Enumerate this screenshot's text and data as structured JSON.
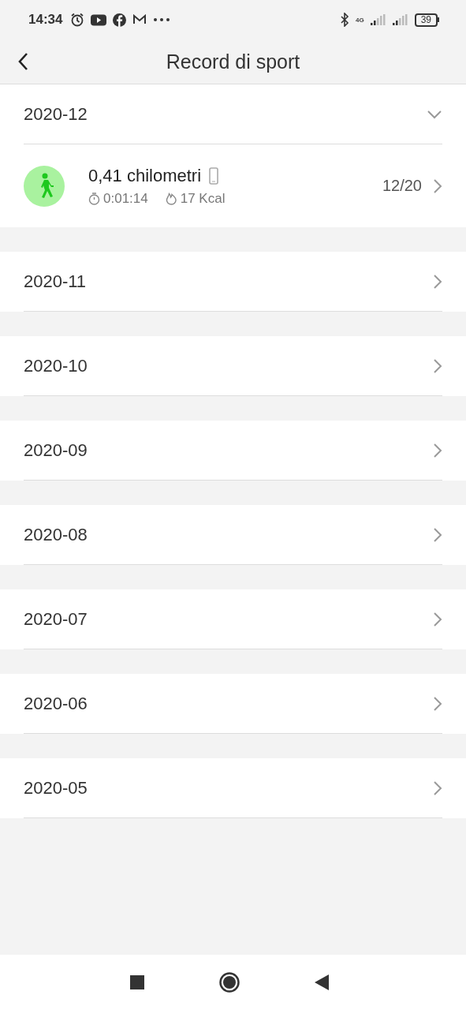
{
  "status_bar": {
    "time": "14:34",
    "network": "4G",
    "battery": "39"
  },
  "header": {
    "title": "Record di sport"
  },
  "months": [
    {
      "label": "2020-12",
      "expanded": true,
      "records": [
        {
          "distance": "0,41 chilometri",
          "duration": "0:01:14",
          "calories": "17 Kcal",
          "date": "12/20"
        }
      ]
    },
    {
      "label": "2020-11",
      "expanded": false
    },
    {
      "label": "2020-10",
      "expanded": false
    },
    {
      "label": "2020-09",
      "expanded": false
    },
    {
      "label": "2020-08",
      "expanded": false
    },
    {
      "label": "2020-07",
      "expanded": false
    },
    {
      "label": "2020-06",
      "expanded": false
    },
    {
      "label": "2020-05",
      "expanded": false
    }
  ]
}
